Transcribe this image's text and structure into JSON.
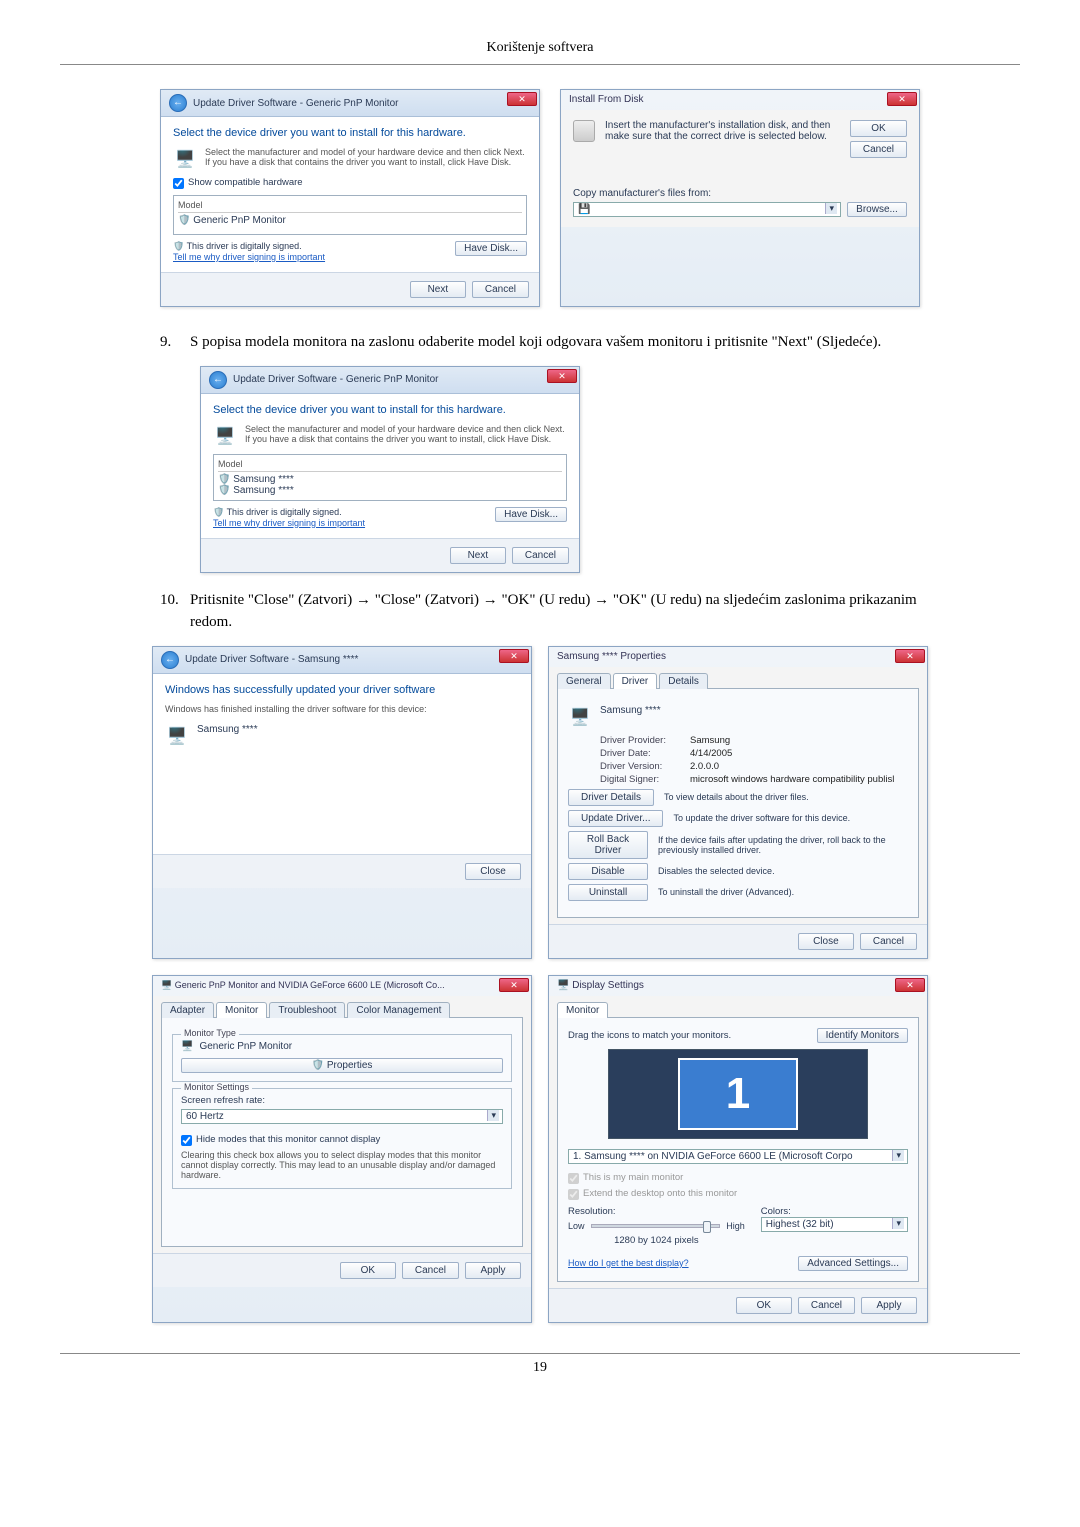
{
  "page": {
    "header_title": "Korištenje softvera",
    "page_number": "19"
  },
  "step9": {
    "number": "9.",
    "text": "S popisa modela monitora na zaslonu odaberite model koji odgovara vašem monitoru i pritisnite \"Next\" (Sljedeće)."
  },
  "step10": {
    "number": "10.",
    "text": "Pritisnite \"Close\" (Zatvori) → \"Close\" (Zatvori) → \"OK\" (U redu) → \"OK\" (U redu) na sljedećim zaslonima prikazanim redom."
  },
  "dialog_update_driver_1": {
    "breadcrumb": "Update Driver Software - Generic PnP Monitor",
    "heading": "Select the device driver you want to install for this hardware.",
    "instruction": "Select the manufacturer and model of your hardware device and then click Next. If you have a disk that contains the driver you want to install, click Have Disk.",
    "compat_checkbox": "Show compatible hardware",
    "list_header": "Model",
    "list_item": "Generic PnP Monitor",
    "signed_text": "This driver is digitally signed.",
    "signed_link": "Tell me why driver signing is important",
    "have_disk_btn": "Have Disk...",
    "next_btn": "Next",
    "cancel_btn": "Cancel"
  },
  "dialog_install_from_disk": {
    "title": "Install From Disk",
    "message": "Insert the manufacturer's installation disk, and then make sure that the correct drive is selected below.",
    "ok_btn": "OK",
    "cancel_btn": "Cancel",
    "copy_label": "Copy manufacturer's files from:",
    "browse_btn": "Browse..."
  },
  "dialog_update_driver_2": {
    "breadcrumb": "Update Driver Software - Generic PnP Monitor",
    "heading": "Select the device driver you want to install for this hardware.",
    "instruction": "Select the manufacturer and model of your hardware device and then click Next. If you have a disk that contains the driver you want to install, click Have Disk.",
    "list_header": "Model",
    "list_item1": "Samsung ****",
    "list_item2": "Samsung ****",
    "signed_text": "This driver is digitally signed.",
    "signed_link": "Tell me why driver signing is important",
    "have_disk_btn": "Have Disk...",
    "next_btn": "Next",
    "cancel_btn": "Cancel"
  },
  "dialog_success": {
    "breadcrumb": "Update Driver Software - Samsung ****",
    "heading": "Windows has successfully updated your driver software",
    "subtext": "Windows has finished installing the driver software for this device:",
    "device": "Samsung ****",
    "close_btn": "Close"
  },
  "dialog_driver_props": {
    "title": "Samsung **** Properties",
    "tabs": {
      "general": "General",
      "driver": "Driver",
      "details": "Details"
    },
    "device_name": "Samsung ****",
    "provider_label": "Driver Provider:",
    "provider_value": "Samsung",
    "date_label": "Driver Date:",
    "date_value": "4/14/2005",
    "version_label": "Driver Version:",
    "version_value": "2.0.0.0",
    "signer_label": "Digital Signer:",
    "signer_value": "microsoft windows hardware compatibility publisl",
    "btn_details": "Driver Details",
    "btn_details_desc": "To view details about the driver files.",
    "btn_update": "Update Driver...",
    "btn_update_desc": "To update the driver software for this device.",
    "btn_rollback": "Roll Back Driver",
    "btn_rollback_desc": "If the device fails after updating the driver, roll back to the previously installed driver.",
    "btn_disable": "Disable",
    "btn_disable_desc": "Disables the selected device.",
    "btn_uninstall": "Uninstall",
    "btn_uninstall_desc": "To uninstall the driver (Advanced).",
    "close_btn": "Close",
    "cancel_btn": "Cancel"
  },
  "dialog_monitor_props": {
    "title": "Generic PnP Monitor and NVIDIA GeForce 6600 LE (Microsoft Co...",
    "tabs": {
      "adapter": "Adapter",
      "monitor": "Monitor",
      "troubleshoot": "Troubleshoot",
      "color": "Color Management"
    },
    "group_type": "Monitor Type",
    "type_value": "Generic PnP Monitor",
    "properties_btn": "Properties",
    "group_settings": "Monitor Settings",
    "refresh_label": "Screen refresh rate:",
    "refresh_value": "60 Hertz",
    "hide_checkbox": "Hide modes that this monitor cannot display",
    "hide_desc": "Clearing this check box allows you to select display modes that this monitor cannot display correctly. This may lead to an unusable display and/or damaged hardware.",
    "ok_btn": "OK",
    "cancel_btn": "Cancel",
    "apply_btn": "Apply"
  },
  "dialog_display_settings": {
    "title": "Display Settings",
    "tab_monitor": "Monitor",
    "drag_text": "Drag the icons to match your monitors.",
    "identify_btn": "Identify Monitors",
    "monitor_number": "1",
    "dropdown_value": "1. Samsung **** on NVIDIA GeForce 6600 LE (Microsoft Corpo",
    "check_main": "This is my main monitor",
    "check_extend": "Extend the desktop onto this monitor",
    "resolution_label": "Resolution:",
    "low_label": "Low",
    "high_label": "High",
    "res_value": "1280 by 1024 pixels",
    "colors_label": "Colors:",
    "colors_value": "Highest (32 bit)",
    "best_display_link": "How do I get the best display?",
    "advanced_btn": "Advanced Settings...",
    "ok_btn": "OK",
    "cancel_btn": "Cancel",
    "apply_btn": "Apply"
  }
}
